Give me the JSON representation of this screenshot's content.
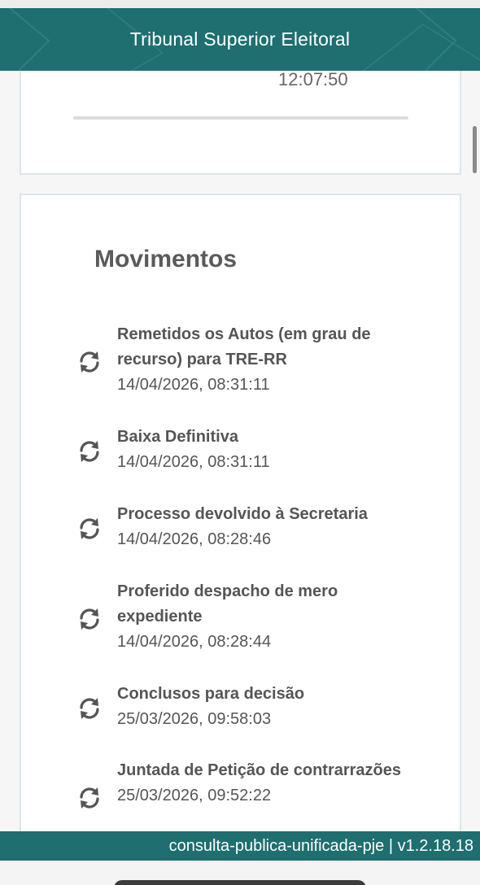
{
  "header": {
    "title": "Tribunal Superior Eleitoral"
  },
  "previous_card": {
    "time": "12:07:50"
  },
  "movimentos": {
    "title": "Movimentos",
    "items": [
      {
        "icon": "sync-icon",
        "title": "Remetidos os Autos (em grau de recurso) para TRE-RR",
        "date": "14/04/2026, 08:31:11"
      },
      {
        "icon": "sync-icon",
        "title": "Baixa Definitiva",
        "date": "14/04/2026, 08:31:11"
      },
      {
        "icon": "sync-icon",
        "title": "Processo devolvido à Secretaria",
        "date": "14/04/2026, 08:28:46"
      },
      {
        "icon": "sync-icon",
        "title": "Proferido despacho de mero expediente",
        "date": "14/04/2026, 08:28:44"
      },
      {
        "icon": "sync-icon",
        "title": "Conclusos para decisão",
        "date": "25/03/2026, 09:58:03"
      },
      {
        "icon": "sync-icon",
        "title": "Juntada de Petição de contrarrazões",
        "date": "25/03/2026, 09:52:22"
      }
    ]
  },
  "footer": {
    "version_text": "consulta-publica-unificada-pje | v1.2.18.18"
  },
  "colors": {
    "brand": "#1f6e70",
    "border": "#d9e6ec",
    "text": "#555555"
  }
}
